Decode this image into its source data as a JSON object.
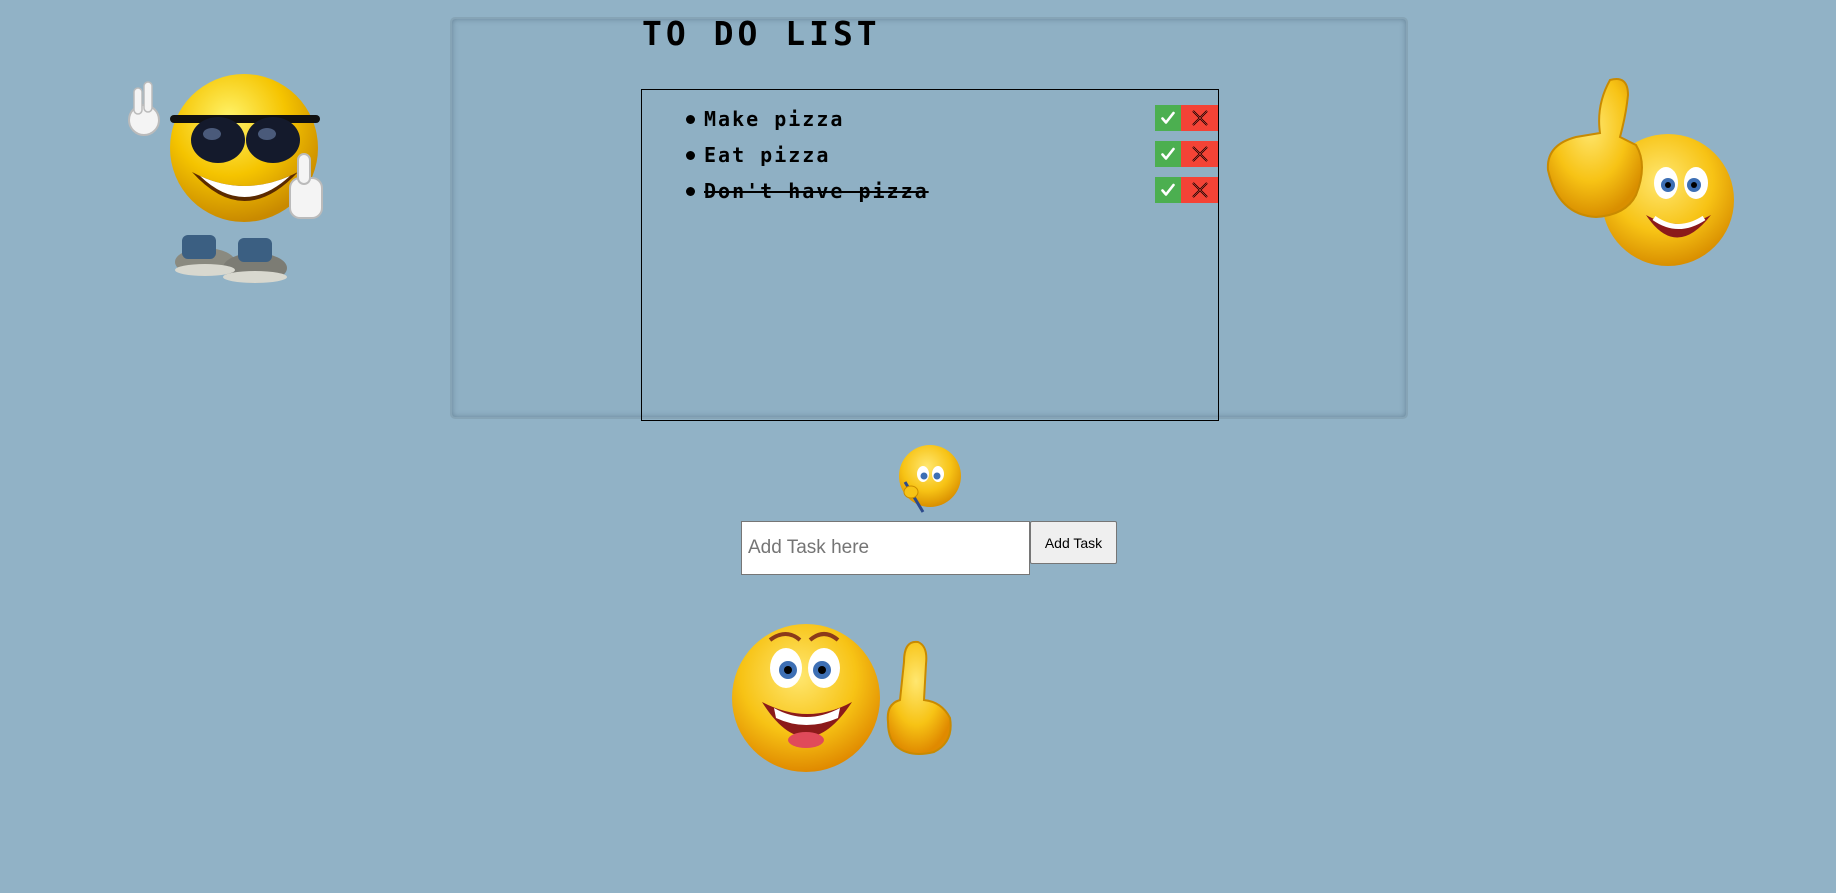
{
  "header": {
    "title": "TO DO LIST"
  },
  "tasks": [
    {
      "text": "Make pizza",
      "completed": false
    },
    {
      "text": "Eat pizza",
      "completed": false
    },
    {
      "text": "Don't have pizza",
      "completed": true
    }
  ],
  "add_form": {
    "input_placeholder": "Add Task here",
    "input_value": "",
    "button_label": "Add Task"
  },
  "colors": {
    "page_background": "#91b2c6",
    "check_button": "#4caf50",
    "delete_button": "#f44336",
    "emoji_yellow": "#f5c400"
  },
  "icons": {
    "complete": "checkmark-icon",
    "delete": "x-icon",
    "decorations": [
      "cool-emoji-sunglasses",
      "thumbs-up-emoji",
      "writing-emoji",
      "pointing-up-emoji"
    ]
  }
}
